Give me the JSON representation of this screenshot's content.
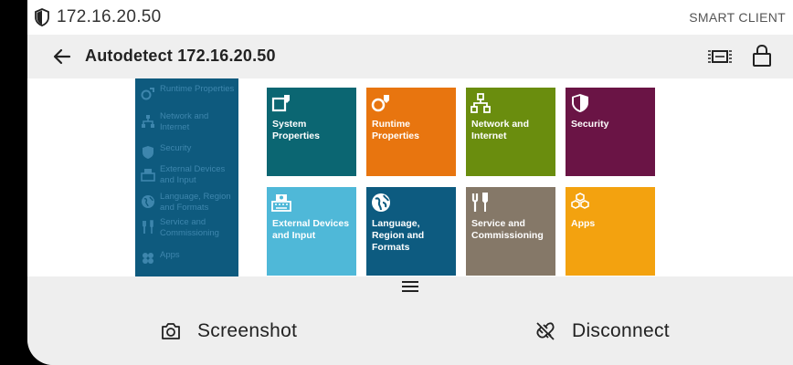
{
  "statusbar": {
    "address": "172.16.20.50",
    "app_name": "SMART CLIENT"
  },
  "appbar": {
    "title": "Autodetect 172.16.20.50"
  },
  "sidebar": {
    "items": [
      {
        "label": "Runtime Properties",
        "icon": "runtime-icon"
      },
      {
        "label": "Network and Internet",
        "icon": "network-icon"
      },
      {
        "label": "Security",
        "icon": "shield-icon"
      },
      {
        "label": "External Devices and Input",
        "icon": "devices-icon"
      },
      {
        "label": "Language, Region and Formats",
        "icon": "globe-icon"
      },
      {
        "label": "Service and Commissioning",
        "icon": "tools-icon"
      },
      {
        "label": "Apps",
        "icon": "apps-icon"
      }
    ]
  },
  "tiles": [
    {
      "label": "System Properties",
      "color": "#0b6672",
      "icon": "system-properties-icon"
    },
    {
      "label": "Runtime Properties",
      "color": "#e8750f",
      "icon": "runtime-properties-icon"
    },
    {
      "label": "Network and Internet",
      "color": "#6a8d0e",
      "icon": "network-icon"
    },
    {
      "label": "Security",
      "color": "#6a1445",
      "icon": "shield-icon"
    },
    {
      "label": "External Devices and Input",
      "color": "#4fb8d8",
      "icon": "devices-icon"
    },
    {
      "label": "Language, Region and Formats",
      "color": "#0d5b80",
      "icon": "globe-icon"
    },
    {
      "label": "Service and Commissioning",
      "color": "#857868",
      "icon": "tools-icon"
    },
    {
      "label": "Apps",
      "color": "#f3a20f",
      "icon": "apps-icon"
    }
  ],
  "bottom": {
    "screenshot_label": "Screenshot",
    "disconnect_label": "Disconnect"
  }
}
